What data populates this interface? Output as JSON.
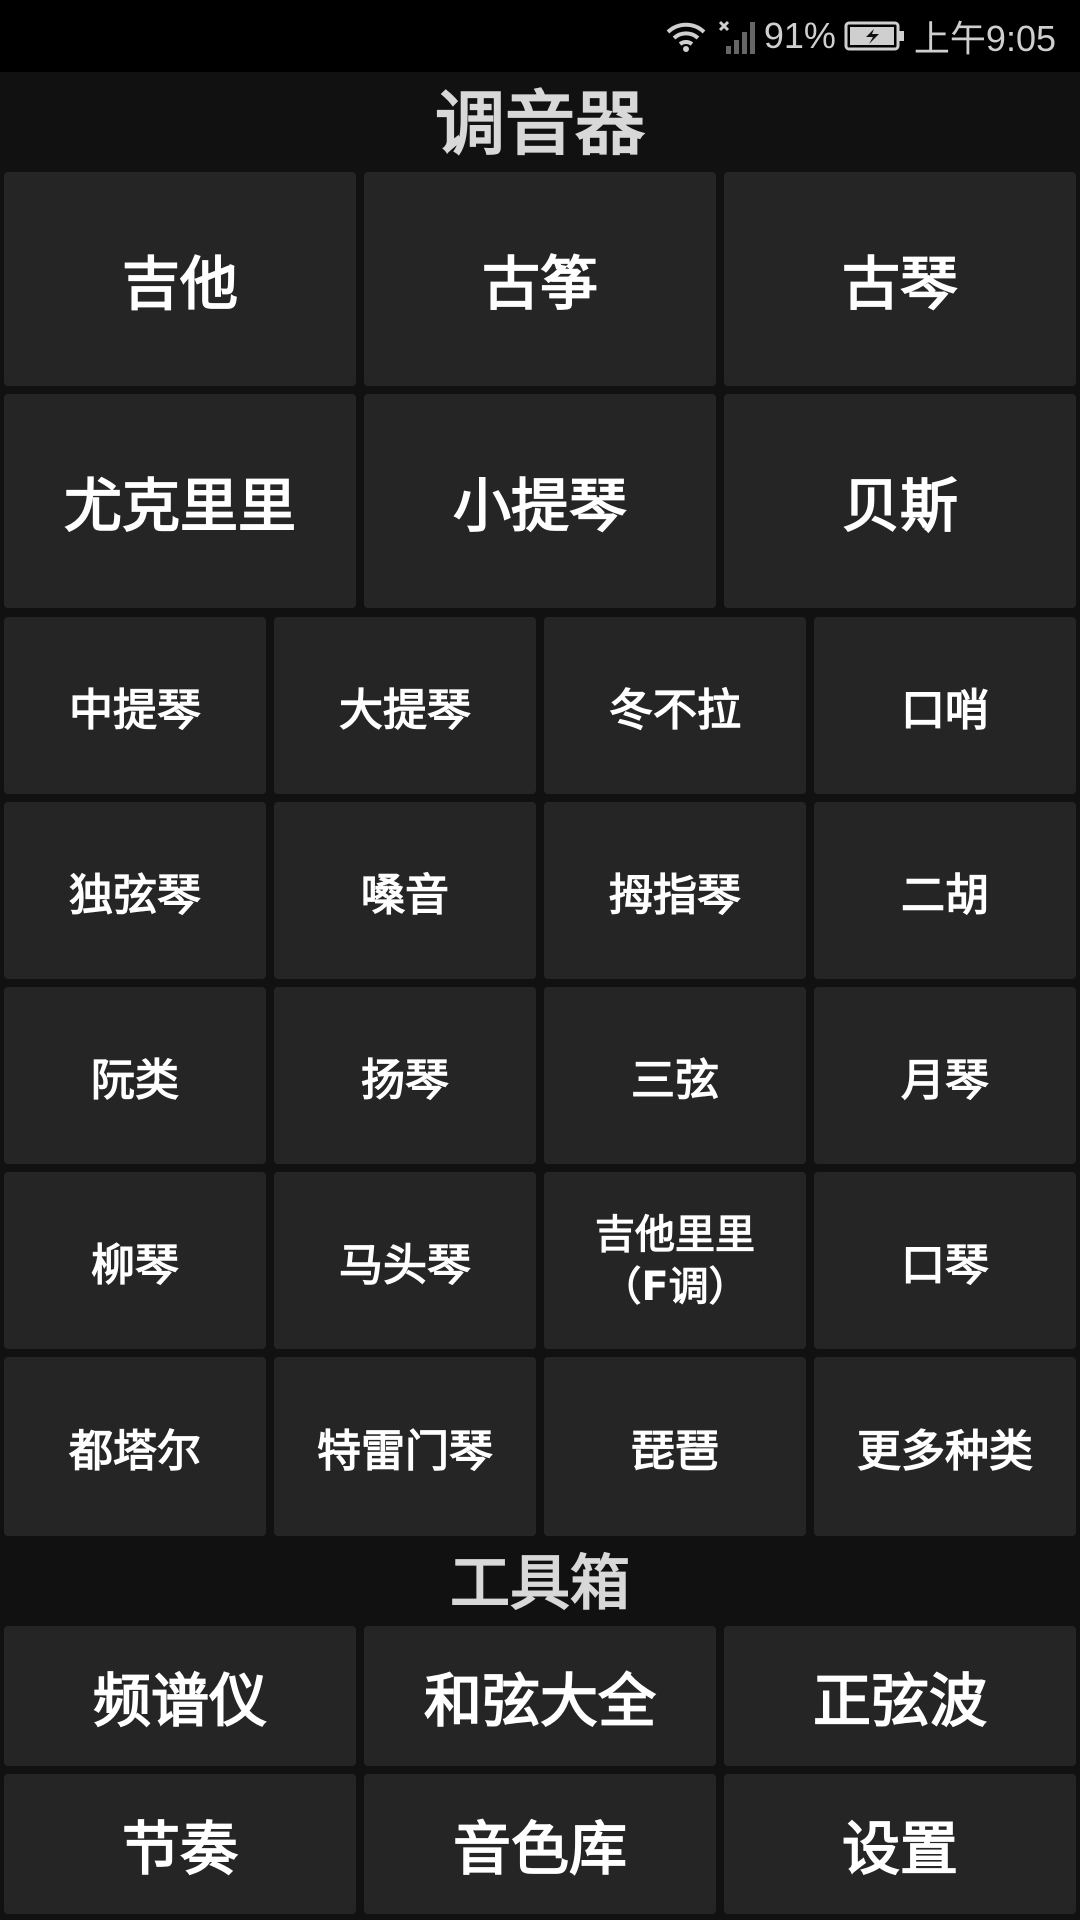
{
  "status_bar": {
    "battery_percent": "91%",
    "time": "上午9:05",
    "icons": [
      "wifi-icon",
      "no-signal-icon",
      "battery-charging-icon"
    ]
  },
  "tuner": {
    "title": "调音器",
    "primary": [
      "吉他",
      "古筝",
      "古琴",
      "尤克里里",
      "小提琴",
      "贝斯"
    ],
    "secondary": [
      "中提琴",
      "大提琴",
      "冬不拉",
      "口哨",
      "独弦琴",
      "嗓音",
      "拇指琴",
      "二胡",
      "阮类",
      "扬琴",
      "三弦",
      "月琴",
      "柳琴",
      "马头琴",
      "吉他里里\n（F调）",
      "口琴",
      "都塔尔",
      "特雷门琴",
      "琵琶",
      "更多种类"
    ]
  },
  "toolbox": {
    "title": "工具箱",
    "items": [
      "频谱仪",
      "和弦大全",
      "正弦波",
      "节奏",
      "音色库",
      "设置"
    ]
  },
  "colors": {
    "status_bar_bg": "#000000",
    "page_bg": "#111111",
    "tile_bg": "#252525",
    "title_text": "#d8d8d8",
    "tile_text": "#ffffff"
  }
}
